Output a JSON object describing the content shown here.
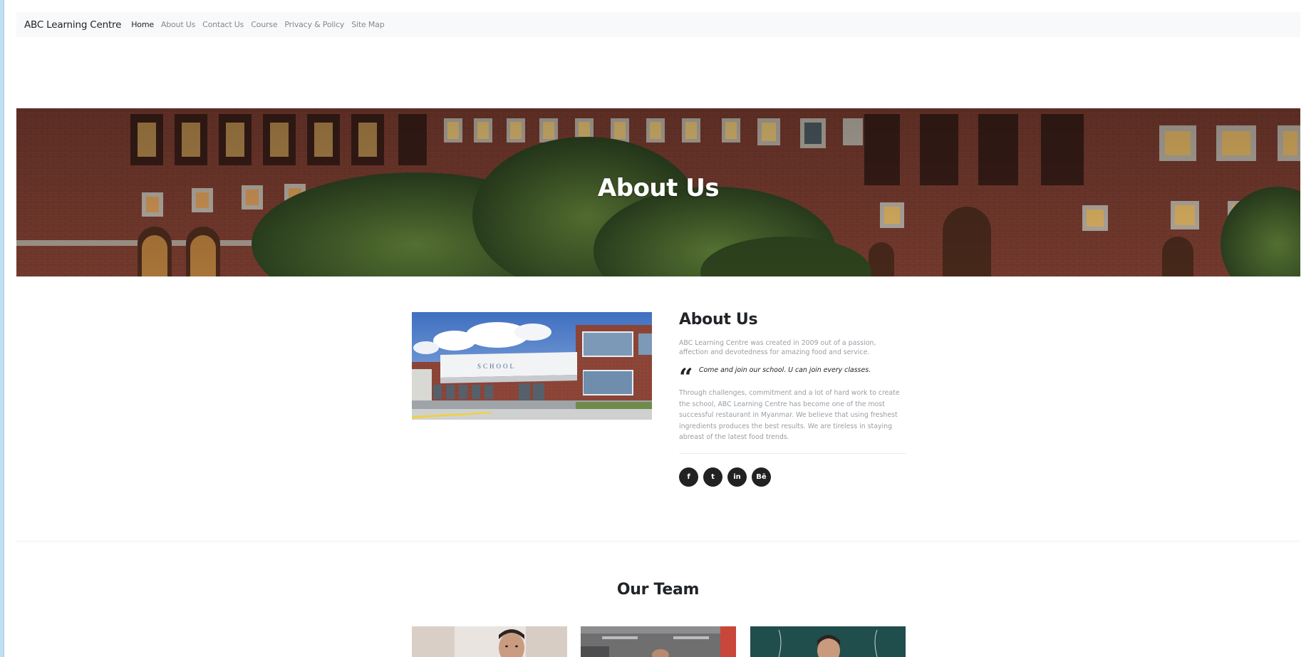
{
  "navbar": {
    "brand": "ABC Learning Centre",
    "links": [
      {
        "label": "Home",
        "active": true
      },
      {
        "label": "About Us",
        "active": false
      },
      {
        "label": "Contact Us",
        "active": false
      },
      {
        "label": "Course",
        "active": false
      },
      {
        "label": "Privacy & Policy",
        "active": false
      },
      {
        "label": "Site Map",
        "active": false
      }
    ]
  },
  "hero": {
    "title": "About Us"
  },
  "about": {
    "heading": "About Us",
    "intro": "ABC Learning Centre was created in 2009 out of a passion, affection and devotedness for amazing food and service.",
    "quote": "Come and join our school. U can join every classes.",
    "body": "Through challenges, commitment and a lot of hard work to create the school, ABC Learning Centre has become one of the most successful restaurant in Myanmar. We believe that using freshest ingredients produces the best results. We are tireless in staying abreast of the latest food trends.",
    "image_sign": "SCHOOL",
    "socials": [
      {
        "icon": "facebook-icon",
        "glyph": "f"
      },
      {
        "icon": "twitter-icon",
        "glyph": "t"
      },
      {
        "icon": "linkedin-icon",
        "glyph": "in"
      },
      {
        "icon": "behance-icon",
        "glyph": "Bē"
      }
    ]
  },
  "team": {
    "title": "Our Team"
  },
  "colors": {
    "text_dark": "#212529",
    "text_muted": "#9a9ea3",
    "navbar_bg": "#f8f9fa",
    "social_bg": "#222222",
    "brick": "#7a3b2e"
  }
}
